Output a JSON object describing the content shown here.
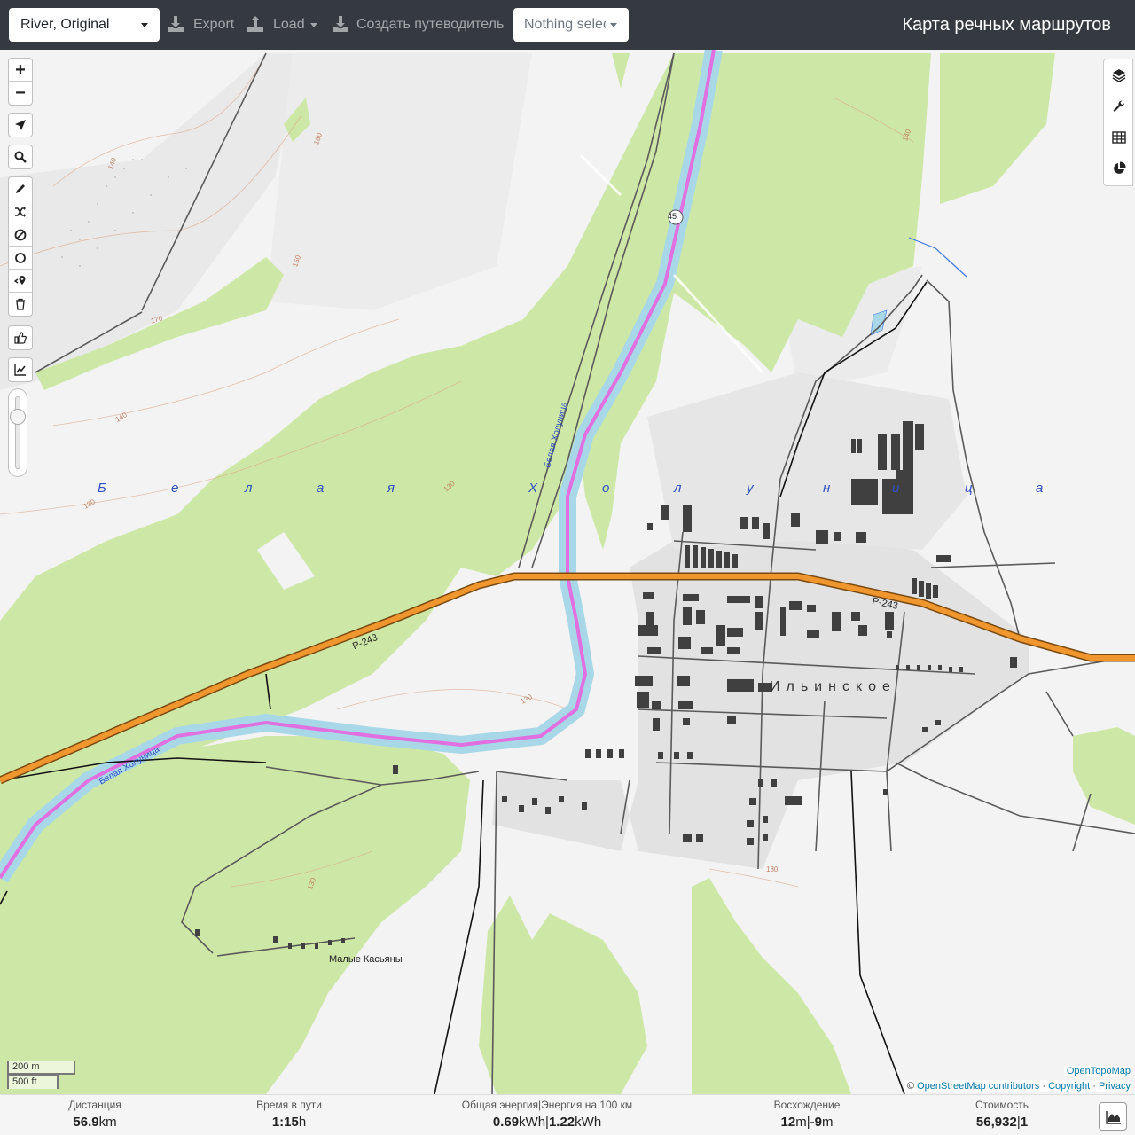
{
  "header": {
    "profile_select": "River, Original",
    "export_label": "Export",
    "load_label": "Load",
    "guide_label": "Создать путеводитель",
    "nothing_selected": "Nothing selected",
    "app_title": "Карта речных маршрутов"
  },
  "map": {
    "zoom_in": "+",
    "zoom_out": "−",
    "labels": {
      "valley_letters": [
        "Б",
        "е",
        "л",
        "а",
        "я",
        "Х",
        "о",
        "л",
        "у",
        "н",
        "и",
        "ц",
        "а"
      ],
      "river_1": "Белая Холуница",
      "river_2": "Белая Холуница",
      "road_1": "Р-243",
      "road_2": "Р-243",
      "town": "Ильинское",
      "village": "Малые Касьяны",
      "shield_45": "45"
    },
    "contours": [
      "160",
      "150",
      "140",
      "170",
      "130",
      "130",
      "130",
      "130",
      "140",
      "140",
      "130"
    ],
    "scale_m": "200 m",
    "scale_ft": "500 ft",
    "attribution_topo": "OpenTopoMap",
    "attribution_prefix": "©",
    "attribution_osm": "OpenStreetMap contributors",
    "attribution_sep1": "·",
    "attribution_copyright": "Copyright",
    "attribution_sep2": "·",
    "attribution_privacy": "Privacy"
  },
  "stats": {
    "distance": {
      "label": "Дистанция",
      "value": "56.9",
      "unit": "km"
    },
    "time": {
      "label": "Время в пути",
      "value": "1:15",
      "unit": "h"
    },
    "energy": {
      "label": "Общая энергия|Энергия на 100 км",
      "value1": "0.69",
      "unit1": "kWh",
      "sep": "|",
      "value2": "1.22",
      "unit2": "kWh"
    },
    "ascent": {
      "label": "Восхождение",
      "value1": "12",
      "unit1": "m",
      "sep": "|",
      "value2": "-9",
      "unit2": "m"
    },
    "cost": {
      "label": "Стоимость",
      "value1": "56,932",
      "sep": "|",
      "value2": "1"
    }
  },
  "colors": {
    "forest": "#cfe9a7",
    "river": "#a8d8e8",
    "route": "#e070e0",
    "road_main": "#f0962e",
    "town": "#e3e3e3",
    "building": "#404040"
  }
}
